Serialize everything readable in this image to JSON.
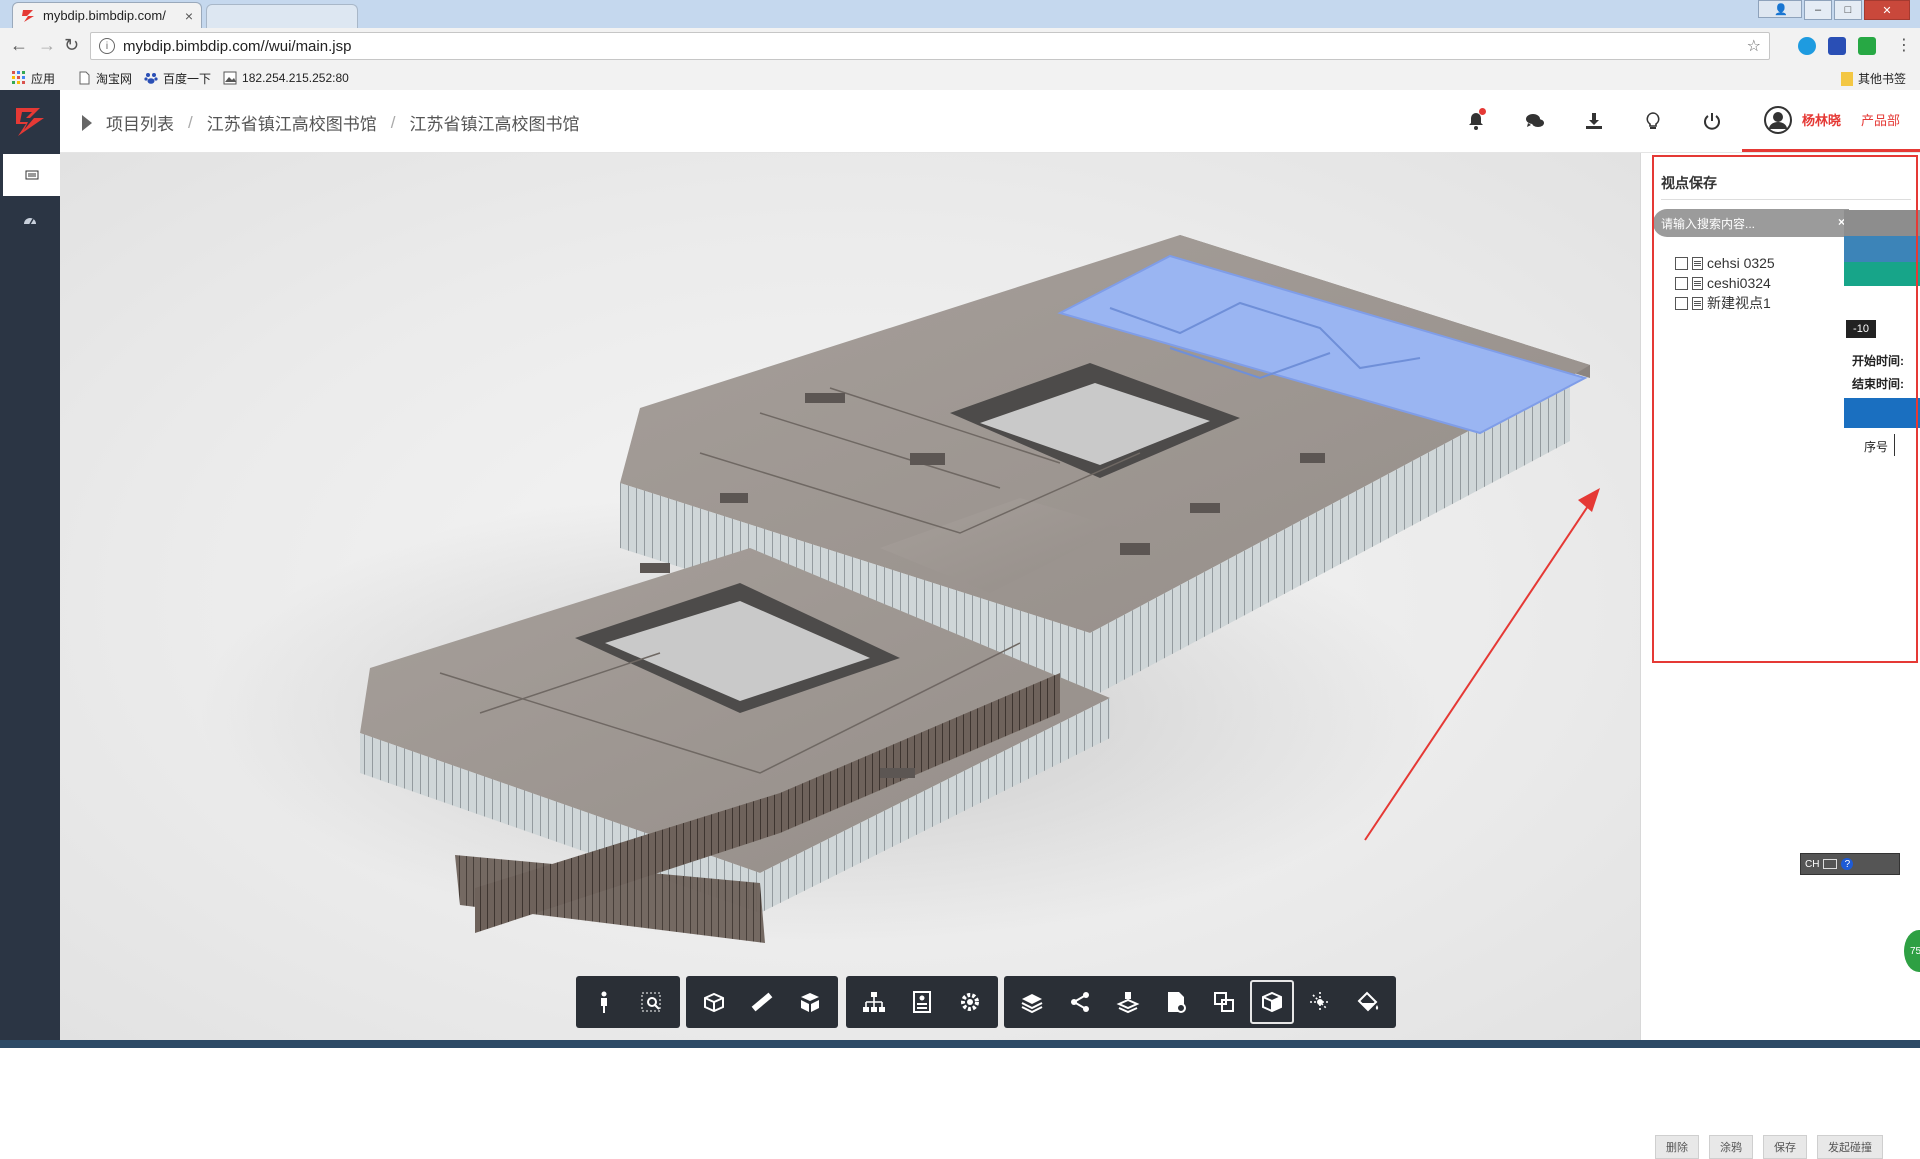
{
  "browser": {
    "tab_title": "mybdip.bimbdip.com/",
    "tab_close": "×",
    "url": "mybdip.bimbdip.com//wui/main.jsp",
    "bookmarks": [
      {
        "label": "应用",
        "icon": "apps-grid-icon"
      },
      {
        "label": "淘宝网",
        "icon": "page-icon"
      },
      {
        "label": "百度一下",
        "icon": "baidu-paw-icon"
      },
      {
        "label": "182.254.215.252:80",
        "icon": "image-icon"
      }
    ],
    "other_bookmarks": "其他书签",
    "window_buttons": [
      "–",
      "□",
      "✕"
    ]
  },
  "app": {
    "brand_color": "#e53935",
    "breadcrumbs": [
      "项目列表",
      "江苏省镇江高校图书馆",
      "江苏省镇江高校图书馆"
    ],
    "breadcrumb_sep": "/",
    "header_icons": [
      "bell-icon",
      "chat-icon",
      "download-icon",
      "lightbulb-icon",
      "power-icon"
    ],
    "user": {
      "name": "杨林晓",
      "department": "产品部"
    }
  },
  "panel": {
    "title": "视点保存",
    "search_placeholder": "请输入搜索内容...",
    "search_clear": "×",
    "viewpoints": [
      "cehsi 0325",
      "ceshi0324",
      "新建视点1"
    ],
    "buttons": [
      "删除",
      "涂鸦",
      "保存",
      "发起碰撞"
    ],
    "side": {
      "tag": "-10",
      "start_time": "开始时间:",
      "end_time": "结束时间:",
      "seq": "序号"
    }
  },
  "overlays": {
    "ime_label": "CH",
    "green_badge": "75"
  },
  "toolbar": {
    "groups": [
      [
        "walk-person-icon",
        "zoom-region-icon"
      ],
      [
        "section-box-icon",
        "measure-ruler-icon",
        "explode-cube-icon"
      ],
      [
        "model-tree-icon",
        "properties-icon",
        "settings-gear-icon"
      ],
      [
        "layers-icon",
        "share-icon",
        "floor-icon",
        "report-doc-icon",
        "compare-icon",
        "view-cube-icon",
        "axis-icon",
        "paint-bucket-icon"
      ]
    ],
    "active": "view-cube-icon"
  }
}
